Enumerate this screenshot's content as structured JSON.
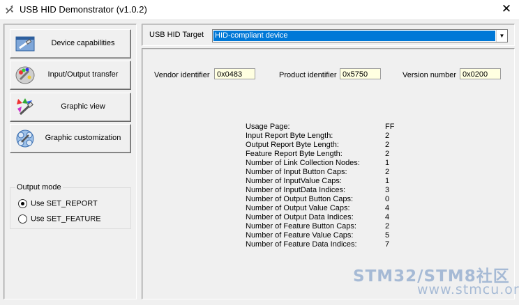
{
  "window": {
    "title": "USB HID Demonstrator (v1.0.2)",
    "close_glyph": "✕"
  },
  "sidebar": {
    "buttons": [
      {
        "label": "Device capabilities",
        "icon": "device-capabilities-icon"
      },
      {
        "label": "Input/Output transfer",
        "icon": "io-transfer-icon"
      },
      {
        "label": "Graphic view",
        "icon": "graphic-view-icon"
      },
      {
        "label": "Graphic customization",
        "icon": "graphic-customization-icon"
      }
    ],
    "output_mode": {
      "title": "Output mode",
      "options": [
        {
          "label": "Use SET_REPORT",
          "selected": true
        },
        {
          "label": "Use SET_FEATURE",
          "selected": false
        }
      ]
    }
  },
  "target": {
    "label": "USB HID Target",
    "selected": "HID-compliant device"
  },
  "ids": {
    "vendor_label": "Vendor identifier",
    "vendor_value": "0x0483",
    "product_label": "Product identifier",
    "product_value": "0x5750",
    "version_label": "Version number",
    "version_value": "0x0200"
  },
  "capabilities": [
    {
      "label": "Usage Page:",
      "value": "FF"
    },
    {
      "label": "Input Report Byte Length:",
      "value": "2"
    },
    {
      "label": "Output Report Byte Length:",
      "value": "2"
    },
    {
      "label": "Feature Report Byte Length:",
      "value": "2"
    },
    {
      "label": "Number of Link Collection Nodes:",
      "value": "1"
    },
    {
      "label": "Number of Input Button Caps:",
      "value": "2"
    },
    {
      "label": "Number of InputValue Caps:",
      "value": "1"
    },
    {
      "label": "Number of InputData Indices:",
      "value": "3"
    },
    {
      "label": "Number of Output Button Caps:",
      "value": "0"
    },
    {
      "label": "Number of Output Value Caps:",
      "value": "4"
    },
    {
      "label": "Number of Output Data Indices:",
      "value": "4"
    },
    {
      "label": "Number of Feature Button Caps:",
      "value": "2"
    },
    {
      "label": "Number of Feature Value Caps:",
      "value": "5"
    },
    {
      "label": "Number of Feature Data Indices:",
      "value": "7"
    }
  ],
  "watermark": {
    "line1": "STM32/STM8社区",
    "line2": "www.stmcu.org"
  }
}
